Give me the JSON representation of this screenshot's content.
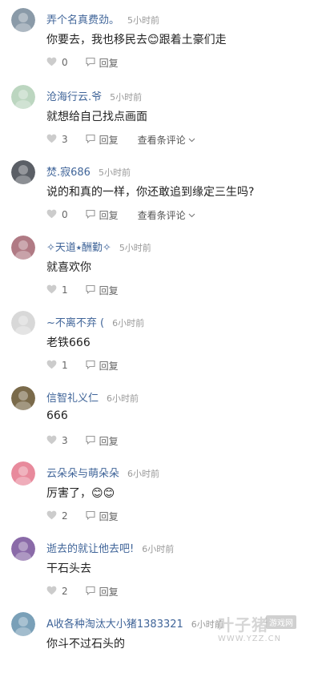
{
  "comments": [
    {
      "username": "弄个名真费劲。",
      "time": "5小时前",
      "content": "你要去，我也移民去😊跟着土豪们走",
      "likes": "0",
      "reply_label": "回复",
      "view_replies": "",
      "avatar_icon": "cat-avatar-icon",
      "avatar_color": "#8a9aa8"
    },
    {
      "username": "沧海行云.爷",
      "time": "5小时前",
      "content": "就想给自己找点画面",
      "likes": "3",
      "reply_label": "回复",
      "view_replies": "查看条评论",
      "avatar_icon": "panda-avatar-icon",
      "avatar_color": "#bcd6c0"
    },
    {
      "username": "焚.寂686",
      "time": "5小时前",
      "content": "说的和真的一样，你还敢追到缘定三生吗?",
      "likes": "0",
      "reply_label": "回复",
      "view_replies": "查看条评论",
      "avatar_icon": "person-avatar-icon",
      "avatar_color": "#5b5f66"
    },
    {
      "username": "✧天道⭑酬勤✧",
      "time": "5小时前",
      "content": "就喜欢你",
      "likes": "1",
      "reply_label": "回复",
      "view_replies": "",
      "avatar_icon": "flower-avatar-icon",
      "avatar_color": "#b07a84"
    },
    {
      "username": "~不离不弃 (",
      "time": "6小时前",
      "content": "老铁666",
      "likes": "1",
      "reply_label": "回复",
      "view_replies": "",
      "avatar_icon": "sketch-avatar-icon",
      "avatar_color": "#d8d8d8"
    },
    {
      "username": "信智礼义仁",
      "time": "6小时前",
      "content": "666",
      "likes": "3",
      "reply_label": "回复",
      "view_replies": "",
      "avatar_icon": "landscape-avatar-icon",
      "avatar_color": "#7a6a4a"
    },
    {
      "username": "云朵朵与萌朵朵",
      "time": "6小时前",
      "content": "厉害了，😊😊",
      "likes": "2",
      "reply_label": "回复",
      "view_replies": "",
      "avatar_icon": "pink-flower-avatar-icon",
      "avatar_color": "#e88a9c"
    },
    {
      "username": "逝去的就让他去吧!",
      "time": "6小时前",
      "content": "干石头去",
      "likes": "2",
      "reply_label": "回复",
      "view_replies": "",
      "avatar_icon": "purple-field-avatar-icon",
      "avatar_color": "#8a6aa8"
    },
    {
      "username": "A收各种淘汰大小猪1383321",
      "time": "6小时前",
      "content": "你斗不过石头的",
      "likes": "",
      "reply_label": "",
      "view_replies": "",
      "avatar_icon": "pig-avatar-icon",
      "avatar_color": "#7aa0b8"
    }
  ],
  "watermark": {
    "main": "叶子猪",
    "box": "游戏网",
    "url": "WWW.YZZ.CN"
  }
}
